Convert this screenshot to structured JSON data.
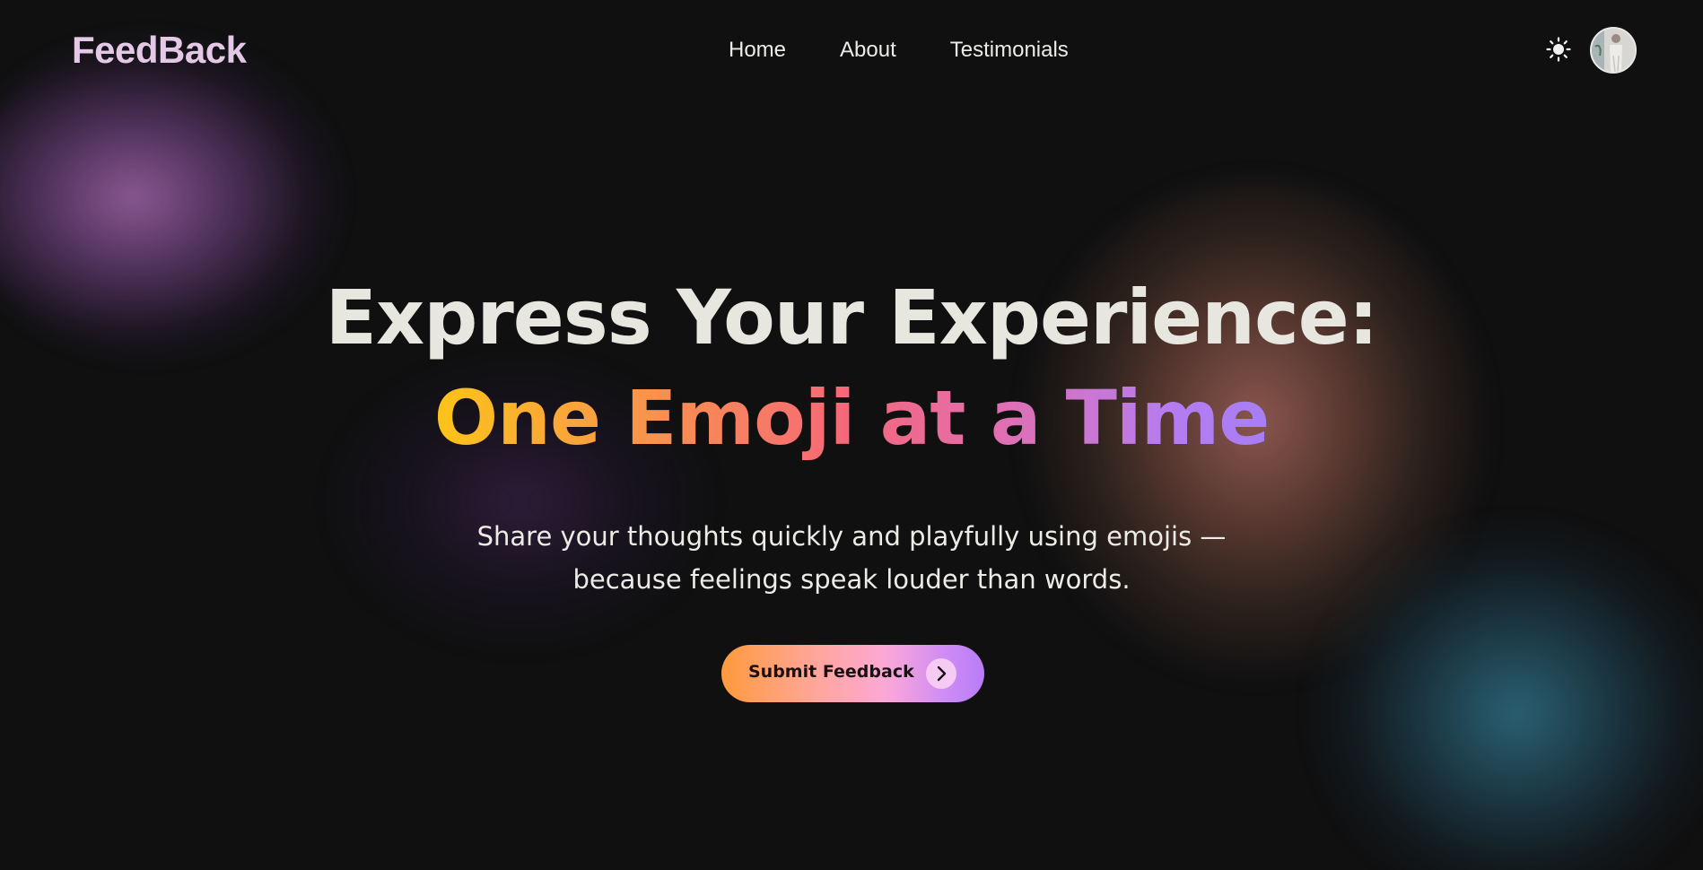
{
  "brand": {
    "name": "FeedBack"
  },
  "nav": {
    "links": [
      {
        "label": "Home"
      },
      {
        "label": "About"
      },
      {
        "label": "Testimonials"
      }
    ]
  },
  "header_actions": {
    "theme_icon": "sun-icon",
    "avatar": "user-avatar"
  },
  "hero": {
    "title_line1": "Express Your Experience:",
    "title_line2": "One Emoji at a Time",
    "subtitle_line1": "Share your thoughts quickly and playfully using emojis —",
    "subtitle_line2": "because feelings speak louder than words.",
    "cta_label": "Submit Feedback",
    "cta_icon": "chevron-right-icon"
  },
  "colors": {
    "background": "#101011",
    "brand": "#e3c9e6",
    "text": "#e7e6df",
    "gradient_start": "#fcc419",
    "gradient_mid": "#f5677a",
    "gradient_end": "#a67ef5",
    "cta_start": "#ff9a3c",
    "cta_end": "#b77cf7"
  }
}
